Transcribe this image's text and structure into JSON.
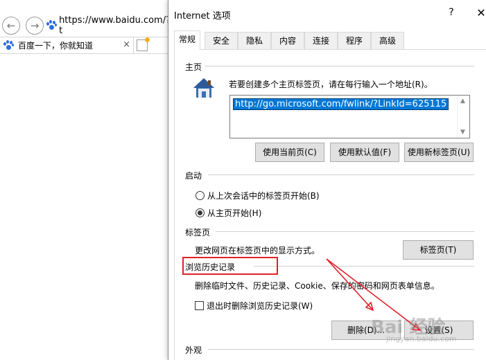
{
  "browser": {
    "url": "https://www.baidu.com/?t",
    "tab_title": "百度一下，你就知道",
    "tab_close": "×"
  },
  "dialog": {
    "title": "Internet 选项",
    "help": "?",
    "close": "✕",
    "tabs": [
      {
        "label": "常规",
        "active": true
      },
      {
        "label": "安全"
      },
      {
        "label": "隐私"
      },
      {
        "label": "内容"
      },
      {
        "label": "连接"
      },
      {
        "label": "程序"
      },
      {
        "label": "高级"
      }
    ],
    "homepage": {
      "heading": "主页",
      "description": "若要创建多个主页标签页，请在每行输入一个地址(R)。",
      "url_value": "http://go.microsoft.com/fwlink/?LinkId=625115",
      "buttons": [
        "使用当前页(C)",
        "使用默认值(F)",
        "使用新标签页(U)"
      ]
    },
    "startup": {
      "heading": "启动",
      "options": [
        {
          "label": "从上次会话中的标签页开始(B)",
          "selected": false
        },
        {
          "label": "从主页开始(H)",
          "selected": true
        }
      ]
    },
    "tabs_section": {
      "heading": "标签页",
      "description": "更改网页在标签页中的显示方式。",
      "button": "标签页(T)"
    },
    "history": {
      "heading": "浏览历史记录",
      "description": "删除临时文件、历史记录、Cookie、保存的密码和网页表单信息。",
      "checkbox_label": "退出时删除浏览历史记录(W)",
      "checkbox_checked": false,
      "delete_button": "删除(D)...",
      "settings_button": "设置(S)"
    },
    "appearance": {
      "heading": "外观"
    }
  },
  "colors": {
    "highlight_box": "#e0202a",
    "annotation_arrow": "#e0202a",
    "selection": "#0078d7"
  },
  "watermark": {
    "text": "Bai 经验",
    "sub": "jingyan.baidu.com"
  }
}
